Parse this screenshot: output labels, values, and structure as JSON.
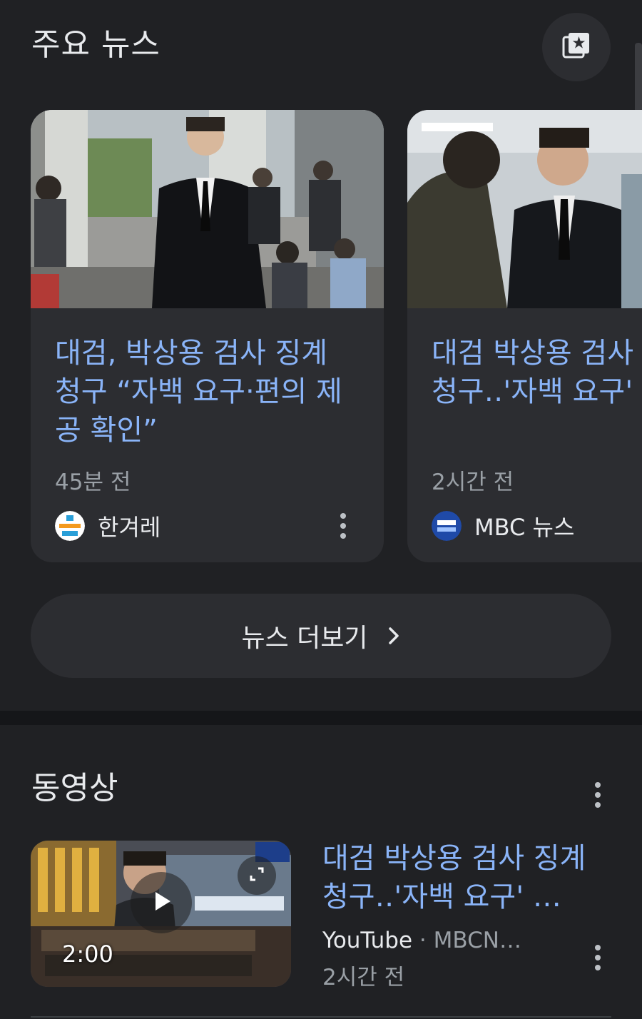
{
  "top_news": {
    "title": "주요 뉴스",
    "cards": [
      {
        "headline": "대검, 박상용 검사 징계 청구 “자백 요구·편의 제공 확인”",
        "time": "45분 전",
        "source": "한겨레"
      },
      {
        "headline_line1": "대검 박상용 검사 징계",
        "headline_line2": "청구‥'자백 요구' 부당",
        "time": "2시간 전",
        "source": "MBC 뉴스"
      }
    ],
    "more_label": "뉴스 더보기"
  },
  "videos": {
    "title": "동영상",
    "item": {
      "headline": "대검 박상용 검사 징계 청구‥'자백 요구' …",
      "platform": "YouTube",
      "channel": "MBCN…",
      "time": "2시간 전",
      "duration": "2:00"
    }
  },
  "icons": {
    "collection": "star-collection-icon",
    "more": "more-vert-icon",
    "chevron": "chevron-right-icon",
    "play": "play-icon",
    "expand": "expand-icon"
  },
  "colors": {
    "background": "#202124",
    "card": "#2c2d31",
    "link": "#8ab4f8",
    "secondary_text": "#9aa0a6"
  }
}
